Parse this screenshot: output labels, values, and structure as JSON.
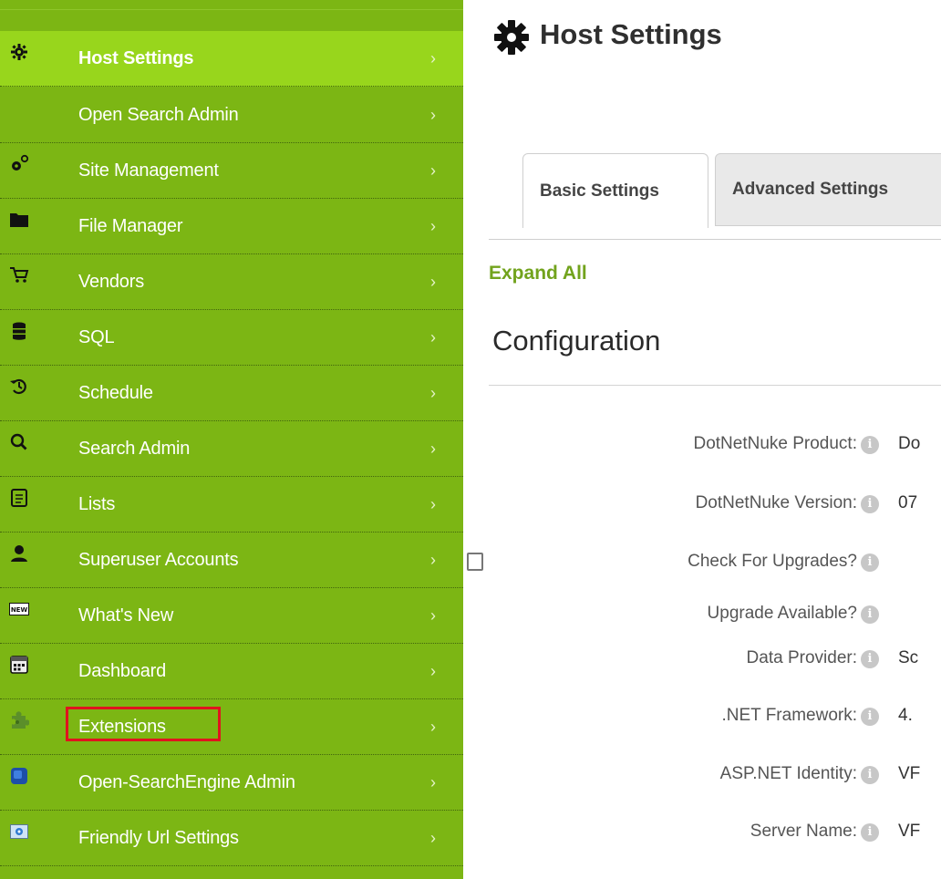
{
  "sidebar": {
    "items": [
      {
        "label": "Host Settings",
        "icon": "gear-icon"
      },
      {
        "label": "Open Search Admin",
        "icon": ""
      },
      {
        "label": "Site Management",
        "icon": "gears-icon"
      },
      {
        "label": "File Manager",
        "icon": "folder-icon"
      },
      {
        "label": "Vendors",
        "icon": "cart-icon"
      },
      {
        "label": "SQL",
        "icon": "database-icon"
      },
      {
        "label": "Schedule",
        "icon": "history-icon"
      },
      {
        "label": "Search Admin",
        "icon": "search-icon"
      },
      {
        "label": "Lists",
        "icon": "list-document-icon"
      },
      {
        "label": "Superuser Accounts",
        "icon": "user-icon"
      },
      {
        "label": "What's New",
        "icon": "new-badge-icon"
      },
      {
        "label": "Dashboard",
        "icon": "dashboard-icon"
      },
      {
        "label": "Extensions",
        "icon": "puzzle-icon"
      },
      {
        "label": "Open-SearchEngine Admin",
        "icon": "cube-icon"
      },
      {
        "label": "Friendly Url Settings",
        "icon": "url-settings-icon"
      }
    ],
    "chevron": "›"
  },
  "main": {
    "title": "Host Settings",
    "tabs": [
      {
        "label": "Basic Settings"
      },
      {
        "label": "Advanced Settings"
      }
    ],
    "expand_all": "Expand All",
    "section_title": "Configuration",
    "fields": [
      {
        "label": "DotNetNuke Product:",
        "value": "Do"
      },
      {
        "label": "DotNetNuke Version:",
        "value": "07"
      },
      {
        "label": "Check For Upgrades?",
        "value": ""
      },
      {
        "label": "Upgrade Available?",
        "value": ""
      },
      {
        "label": "Data Provider:",
        "value": "Sc"
      },
      {
        "label": ".NET Framework:",
        "value": "4."
      },
      {
        "label": "ASP.NET Identity:",
        "value": "VF"
      },
      {
        "label": "Server Name:",
        "value": "VF"
      }
    ],
    "info_glyph": "i"
  },
  "colors": {
    "sidebar_bg": "#7cb614",
    "sidebar_active": "#98d61c",
    "accent_link": "#72a31d",
    "highlight_border": "#e0141e"
  }
}
